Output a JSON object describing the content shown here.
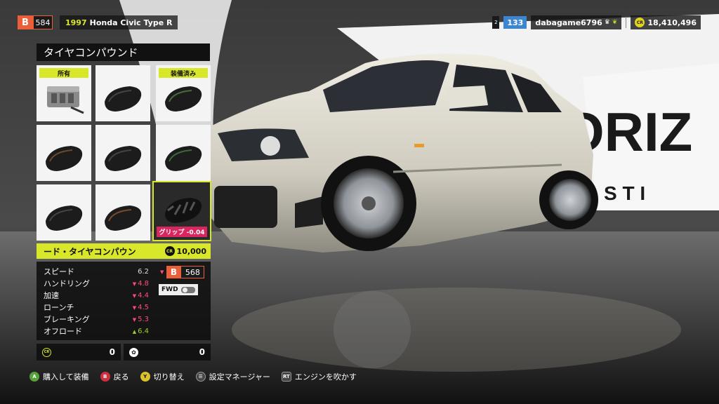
{
  "header": {
    "pi_class": "B",
    "pi_value": "584",
    "car_year": "1997",
    "car_name": "Honda Civic Type R"
  },
  "profile": {
    "level_icon": "2",
    "level": "133",
    "gamertag": "dabagame6796",
    "credits": "18,410,496",
    "cr_symbol": "CR"
  },
  "panel": {
    "title": "タイヤコンパウンド",
    "tiles": [
      {
        "tag": "所有",
        "icon": "toolbox-icon"
      },
      {
        "tag": "",
        "icon": "tire-icon"
      },
      {
        "tag": "装備済み",
        "icon": "tire-icon"
      },
      {
        "tag": "",
        "icon": "tire-icon"
      },
      {
        "tag": "",
        "icon": "tire-icon"
      },
      {
        "tag": "",
        "icon": "tire-icon"
      },
      {
        "tag": "",
        "icon": "tire-icon"
      },
      {
        "tag": "",
        "icon": "tire-icon"
      },
      {
        "tag": "",
        "icon": "tire-icon",
        "badge": "グリップ -0.04"
      }
    ],
    "selected_name": "ード・タイヤコンパウン",
    "selected_price": "10,000"
  },
  "stats": {
    "rows": [
      {
        "label": "スピード",
        "value": "6.2",
        "dir": "none"
      },
      {
        "label": "ハンドリング",
        "value": "4.8",
        "dir": "down"
      },
      {
        "label": "加速",
        "value": "4.4",
        "dir": "down"
      },
      {
        "label": "ローンチ",
        "value": "4.5",
        "dir": "down"
      },
      {
        "label": "ブレーキング",
        "value": "5.3",
        "dir": "down"
      },
      {
        "label": "オフロード",
        "value": "6.4",
        "dir": "up"
      }
    ],
    "new_pi_class": "B",
    "new_pi_value": "568",
    "drivetrain": "FWD"
  },
  "totals": {
    "credits_cost": "0",
    "points_cost": "0"
  },
  "prompts": [
    {
      "button": "A",
      "label": "購入して装備"
    },
    {
      "button": "B",
      "label": "戻る"
    },
    {
      "button": "Y",
      "label": "切り替え"
    },
    {
      "button": "☰",
      "label": "設定マネージャー"
    },
    {
      "button": "RT",
      "label": "エンジンを吹かす"
    }
  ],
  "scene": {
    "banner_text_1": "ORIZ",
    "banner_text_2": "S T I",
    "car_body_color": "#dcd8cc",
    "accent_color": "#d9e72b",
    "pi_color": "#e95f3a",
    "down_color": "#ff4b7b",
    "up_color": "#9bd12d"
  }
}
